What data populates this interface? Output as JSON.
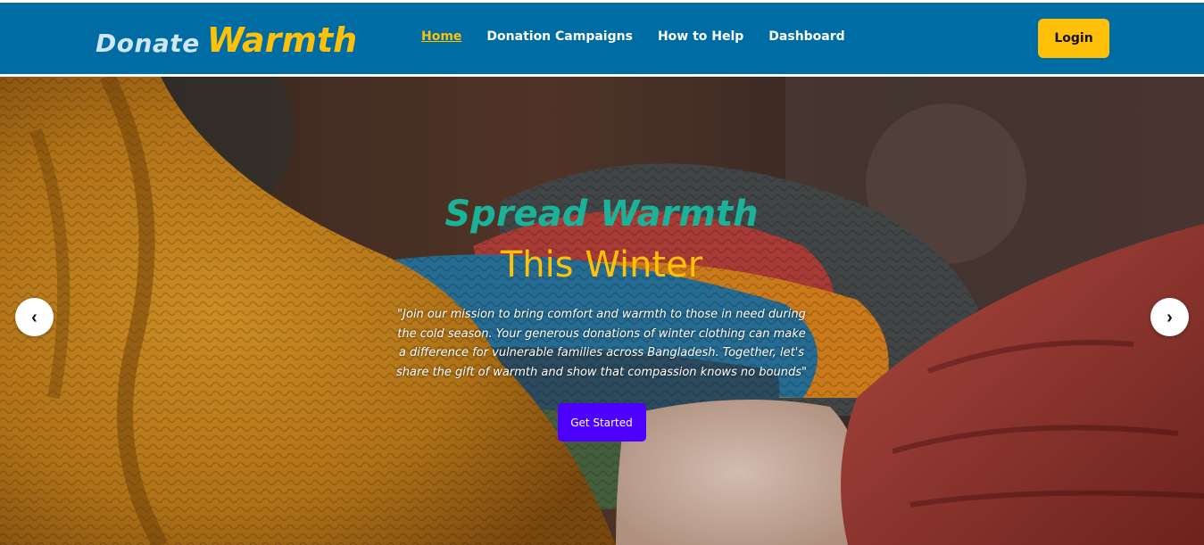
{
  "brand": {
    "part1": "Donate",
    "part2": "Warmth"
  },
  "nav": {
    "items": [
      {
        "label": "Home",
        "active": true
      },
      {
        "label": "Donation Campaigns",
        "active": false
      },
      {
        "label": "How to Help",
        "active": false
      },
      {
        "label": "Dashboard",
        "active": false
      }
    ]
  },
  "header": {
    "login_label": "Login"
  },
  "hero": {
    "headline_1": "Spread Warmth",
    "headline_2": "This Winter",
    "blurb": "\"Join our mission to bring comfort and warmth to those in need during the cold season. Your generous donations of winter clothing can make a difference for vulnerable families across Bangladesh. Together, let's share the gift of warmth and show that compassion knows no bounds\"",
    "cta_label": "Get Started",
    "prev_arrow": "‹",
    "next_arrow": "›"
  },
  "colors": {
    "header_bg": "#006ca4",
    "accent_yellow": "#ffc107",
    "headline_teal": "#1ab39a",
    "cta_purple": "#4d00ff"
  },
  "icons": {
    "prev": "chevron-left-icon",
    "next": "chevron-right-icon"
  }
}
